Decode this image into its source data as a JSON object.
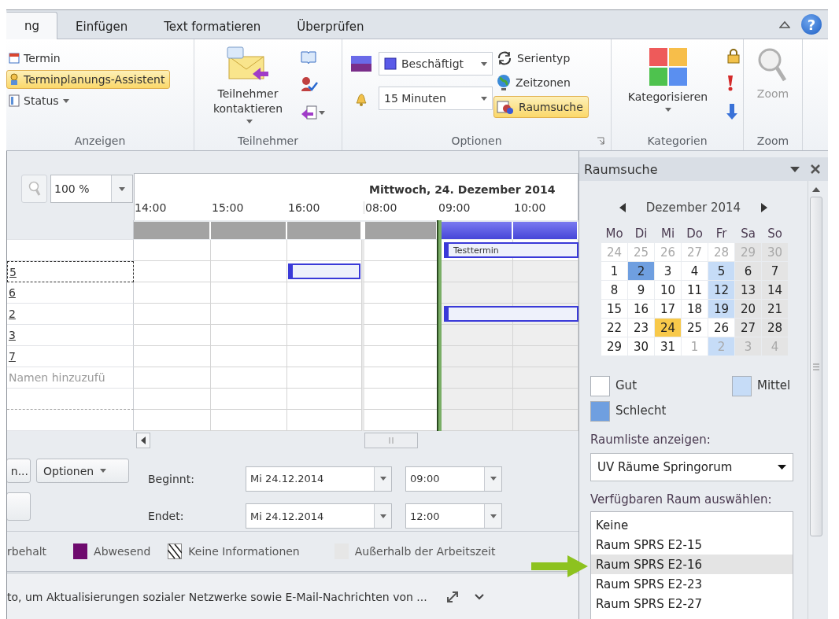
{
  "tabs": [
    {
      "label": "ng",
      "selected": true
    },
    {
      "label": "Einfügen",
      "selected": false
    },
    {
      "label": "Text formatieren",
      "selected": false
    },
    {
      "label": "Überprüfen",
      "selected": false
    }
  ],
  "help_button": "?",
  "ribbon": {
    "anzeigen": {
      "title": "Anzeigen",
      "items": [
        {
          "label": "Termin",
          "kind": "button",
          "selected": false
        },
        {
          "label": "Terminplanungs-Assistent",
          "kind": "button",
          "selected": true
        },
        {
          "label": "Status",
          "kind": "menu",
          "selected": false
        }
      ]
    },
    "teilnehmer": {
      "title": "Teilnehmer",
      "contact_button": "Teilnehmer kontaktieren"
    },
    "optionen": {
      "title": "Optionen",
      "show_as": "Beschäftigt",
      "reminder": "15 Minuten",
      "items": [
        {
          "label": "Serientyp",
          "selected": false
        },
        {
          "label": "Zeitzonen",
          "selected": false
        },
        {
          "label": "Raumsuche",
          "selected": true
        }
      ]
    },
    "kategorien": {
      "title": "Kategorien",
      "button": "Kategorisieren"
    },
    "zoom": {
      "title": "Zoom",
      "button": "Zoom",
      "disabled": true
    }
  },
  "scheduler": {
    "zoom": "100 %",
    "date_heading": "Mittwoch, 24. Dezember 2014",
    "times": [
      {
        "label": "14:00",
        "new_day": false
      },
      {
        "label": "15:00",
        "new_day": false
      },
      {
        "label": "16:00",
        "new_day": false
      },
      {
        "label": "08:00",
        "new_day": true
      },
      {
        "label": "09:00",
        "new_day": false
      },
      {
        "label": "10:00",
        "new_day": false
      }
    ],
    "summary_slots": [
      {
        "busy": false
      },
      {
        "busy": false
      },
      {
        "busy": false
      },
      {
        "busy": false
      },
      {
        "busy": true
      },
      {
        "busy": true
      }
    ],
    "organizer": {
      "appointment": "Testtermin",
      "slots": [
        {
          "busy": false
        },
        {
          "busy": false
        },
        {
          "busy": false
        },
        {
          "busy": false
        },
        {
          "busy": true
        },
        {
          "busy": true
        }
      ]
    },
    "attendees": [
      {
        "name": "5",
        "focused": true,
        "slots": [
          {
            "busy": false
          },
          {
            "busy": false
          },
          {
            "busy": true
          },
          {
            "busy": false
          },
          {
            "busy": false
          },
          {
            "busy": false
          }
        ]
      },
      {
        "name": "6",
        "focused": false,
        "slots": [
          {
            "busy": false
          },
          {
            "busy": false
          },
          {
            "busy": false
          },
          {
            "busy": false
          },
          {
            "busy": false
          },
          {
            "busy": false
          }
        ]
      },
      {
        "name": "2",
        "focused": false,
        "slots": [
          {
            "busy": false
          },
          {
            "busy": false
          },
          {
            "busy": false
          },
          {
            "busy": false
          },
          {
            "busy": true
          },
          {
            "busy": true
          }
        ]
      },
      {
        "name": "3",
        "focused": false,
        "slots": [
          {
            "busy": false
          },
          {
            "busy": false
          },
          {
            "busy": false
          },
          {
            "busy": false
          },
          {
            "busy": false
          },
          {
            "busy": false
          }
        ]
      },
      {
        "name": "7",
        "focused": false,
        "slots": [
          {
            "busy": false
          },
          {
            "busy": false
          },
          {
            "busy": false
          },
          {
            "busy": false
          },
          {
            "busy": false
          },
          {
            "busy": false
          }
        ]
      }
    ],
    "add_placeholder": "Namen hinzuzufü"
  },
  "controls": {
    "buttons": [
      {
        "label": "n...",
        "kind": "button"
      },
      {
        "label": "Optionen",
        "kind": "menu"
      }
    ],
    "start": {
      "label": "Beginnt:",
      "date": "Mi 24.12.2014",
      "time": "09:00"
    },
    "end": {
      "label": "Endet:",
      "date": "Mi 24.12.2014",
      "time": "12:00"
    }
  },
  "legend": [
    {
      "label": "rbehalt",
      "kind": "text"
    },
    {
      "label": "Abwesend",
      "kind": "swatch",
      "color": "#6e0a6e"
    },
    {
      "label": "Keine Informationen",
      "kind": "hatched"
    },
    {
      "label": "Außerhalb der Arbeitszeit",
      "kind": "swatch",
      "color": "#e6e6e6"
    }
  ],
  "status_bar": {
    "text": "to, um Aktualisierungen sozialer Netzwerke sowie E-Mail-Nachrichten von ..."
  },
  "room_finder": {
    "title": "Raumsuche",
    "month": "Dezember 2014",
    "weekdays": [
      "Mo",
      "Di",
      "Mi",
      "Do",
      "Fr",
      "Sa",
      "So"
    ],
    "weeks": [
      [
        {
          "d": "24",
          "current": false,
          "color": "#ffffff"
        },
        {
          "d": "25",
          "current": false,
          "color": "#ffffff"
        },
        {
          "d": "26",
          "current": false,
          "color": "#ffffff"
        },
        {
          "d": "27",
          "current": false,
          "color": "#ffffff"
        },
        {
          "d": "28",
          "current": false,
          "color": "#ffffff"
        },
        {
          "d": "29",
          "current": false,
          "color": "#e4e4e4"
        },
        {
          "d": "30",
          "current": false,
          "color": "#e4e4e4"
        }
      ],
      [
        {
          "d": "1",
          "current": true,
          "color": "#ffffff"
        },
        {
          "d": "2",
          "current": true,
          "color": "#6f9fe0"
        },
        {
          "d": "3",
          "current": true,
          "color": "#ffffff"
        },
        {
          "d": "4",
          "current": true,
          "color": "#ffffff"
        },
        {
          "d": "5",
          "current": true,
          "color": "#c6dcf7"
        },
        {
          "d": "6",
          "current": true,
          "color": "#e4e4e4"
        },
        {
          "d": "7",
          "current": true,
          "color": "#e4e4e4"
        }
      ],
      [
        {
          "d": "8",
          "current": true,
          "color": "#ffffff"
        },
        {
          "d": "9",
          "current": true,
          "color": "#ffffff"
        },
        {
          "d": "10",
          "current": true,
          "color": "#ffffff"
        },
        {
          "d": "11",
          "current": true,
          "color": "#ffffff"
        },
        {
          "d": "12",
          "current": true,
          "color": "#c6dcf7"
        },
        {
          "d": "13",
          "current": true,
          "color": "#e4e4e4"
        },
        {
          "d": "14",
          "current": true,
          "color": "#e4e4e4"
        }
      ],
      [
        {
          "d": "15",
          "current": true,
          "color": "#ffffff"
        },
        {
          "d": "16",
          "current": true,
          "color": "#ffffff"
        },
        {
          "d": "17",
          "current": true,
          "color": "#ffffff"
        },
        {
          "d": "18",
          "current": true,
          "color": "#ffffff"
        },
        {
          "d": "19",
          "current": true,
          "color": "#c6dcf7"
        },
        {
          "d": "20",
          "current": true,
          "color": "#e4e4e4"
        },
        {
          "d": "21",
          "current": true,
          "color": "#e4e4e4"
        }
      ],
      [
        {
          "d": "22",
          "current": true,
          "color": "#ffffff"
        },
        {
          "d": "23",
          "current": true,
          "color": "#ffffff"
        },
        {
          "d": "24",
          "current": true,
          "color": "#f8c94a"
        },
        {
          "d": "25",
          "current": true,
          "color": "#ffffff"
        },
        {
          "d": "26",
          "current": true,
          "color": "#ffffff"
        },
        {
          "d": "27",
          "current": true,
          "color": "#e4e4e4"
        },
        {
          "d": "28",
          "current": true,
          "color": "#e4e4e4"
        }
      ],
      [
        {
          "d": "29",
          "current": true,
          "color": "#ffffff"
        },
        {
          "d": "30",
          "current": true,
          "color": "#ffffff"
        },
        {
          "d": "31",
          "current": true,
          "color": "#ffffff"
        },
        {
          "d": "1",
          "current": false,
          "color": "#ffffff"
        },
        {
          "d": "2",
          "current": false,
          "color": "#c6dcf7"
        },
        {
          "d": "3",
          "current": false,
          "color": "#e4e4e4"
        },
        {
          "d": "4",
          "current": false,
          "color": "#e4e4e4"
        }
      ]
    ],
    "legend": [
      {
        "label": "Gut",
        "color": "#ffffff"
      },
      {
        "label": "Mittel",
        "color": "#c6dcf7"
      },
      {
        "label": "Schlecht",
        "color": "#6f9fe0"
      }
    ],
    "room_list_label": "Raumliste anzeigen:",
    "room_list": "UV Räume Springorum",
    "rooms_label": "Verfügbaren Raum auswählen:",
    "rooms": [
      {
        "label": "Keine",
        "selected": false
      },
      {
        "label": "Raum SPRS E2-15",
        "selected": false
      },
      {
        "label": "Raum SPRS E2-16",
        "selected": true
      },
      {
        "label": "Raum SPRS E2-23",
        "selected": false
      },
      {
        "label": "Raum SPRS E2-27",
        "selected": false
      }
    ]
  }
}
